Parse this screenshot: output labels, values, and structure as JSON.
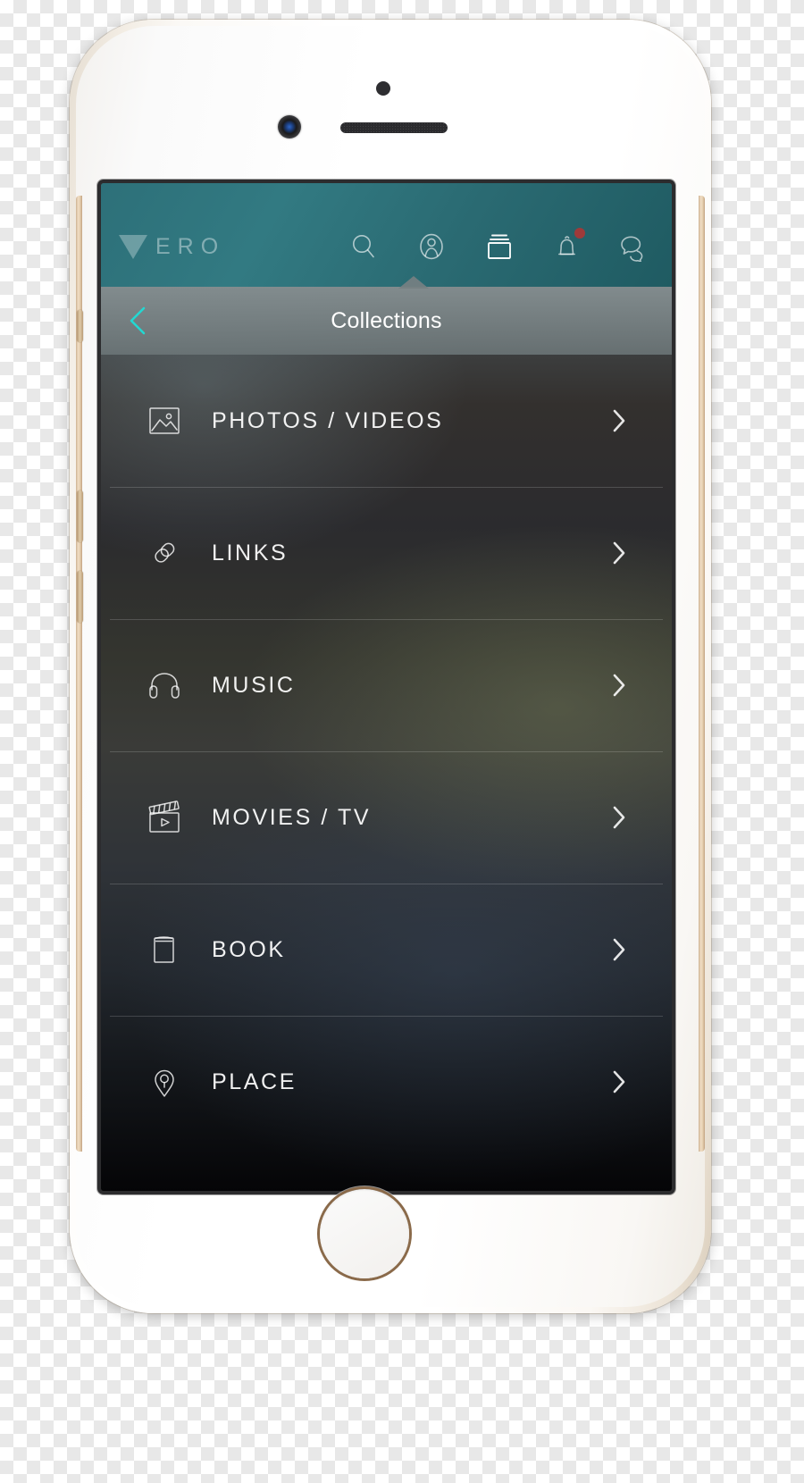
{
  "app": {
    "brand_mark": "vero-triangle-logo",
    "brand_text": "ERO",
    "accent_teal": "#2d7079",
    "accent_cyan": "#23d8d2",
    "badge_color": "#9e3a3a"
  },
  "navbar": {
    "icons": [
      {
        "name": "search-icon",
        "label": "Search",
        "active": false,
        "badge": false
      },
      {
        "name": "profile-icon",
        "label": "Profile",
        "active": false,
        "badge": false
      },
      {
        "name": "collections-icon",
        "label": "Collections",
        "active": true,
        "badge": false
      },
      {
        "name": "bell-icon",
        "label": "Notifications",
        "active": false,
        "badge": true
      },
      {
        "name": "chat-icon",
        "label": "Messages",
        "active": false,
        "badge": false
      }
    ]
  },
  "titlebar": {
    "back_label": "Back",
    "title": "Collections"
  },
  "collections": {
    "items": [
      {
        "label": "PHOTOS / VIDEOS",
        "icon": "image-icon",
        "chevron": "chevron-right-icon"
      },
      {
        "label": "LINKS",
        "icon": "link-icon",
        "chevron": "chevron-right-icon"
      },
      {
        "label": "MUSIC",
        "icon": "headphones-icon",
        "chevron": "chevron-right-icon"
      },
      {
        "label": "MOVIES / TV",
        "icon": "clapperboard-icon",
        "chevron": "chevron-right-icon"
      },
      {
        "label": "BOOK",
        "icon": "book-icon",
        "chevron": "chevron-right-icon"
      },
      {
        "label": "PLACE",
        "icon": "map-pin-icon",
        "chevron": "chevron-right-icon"
      }
    ]
  },
  "device": {
    "name": "smartphone-gold-white",
    "camera": "front-camera",
    "speaker": "earpiece-speaker",
    "sensor": "proximity-sensor",
    "home": "home-button"
  }
}
